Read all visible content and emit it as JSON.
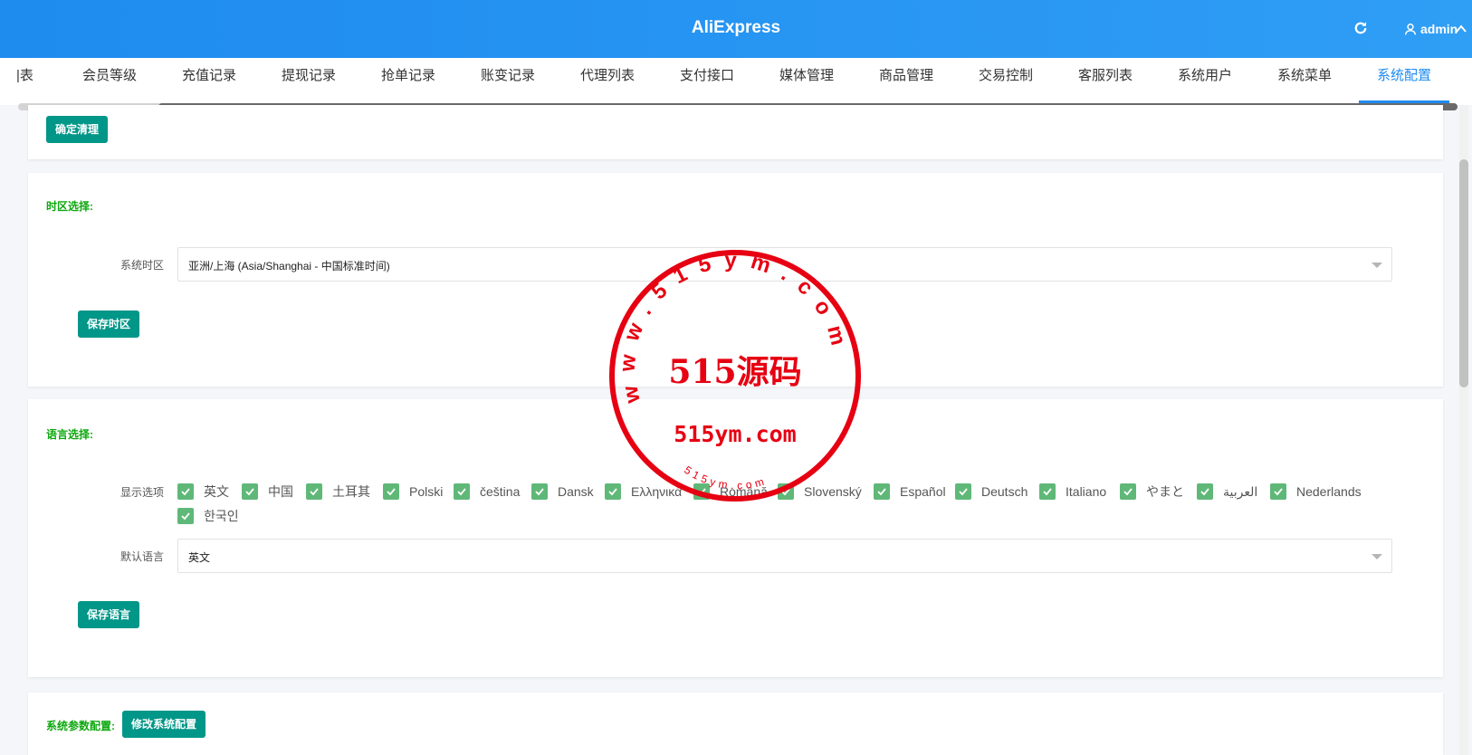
{
  "header": {
    "app_title": "AliExpress",
    "user_name": "admin",
    "refresh_icon": "refresh-icon",
    "user_icon": "user-icon",
    "caret_icon": "caret-up-icon",
    "brand_color": "#1e8bef"
  },
  "tabs": [
    {
      "label": "|表"
    },
    {
      "label": "会员等级"
    },
    {
      "label": "充值记录"
    },
    {
      "label": "提现记录"
    },
    {
      "label": "抢单记录"
    },
    {
      "label": "账变记录"
    },
    {
      "label": "代理列表"
    },
    {
      "label": "支付接口"
    },
    {
      "label": "媒体管理"
    },
    {
      "label": "商品管理"
    },
    {
      "label": "交易控制"
    },
    {
      "label": "客服列表"
    },
    {
      "label": "系统用户"
    },
    {
      "label": "系统菜单"
    },
    {
      "label": "系统配置",
      "active": true
    }
  ],
  "clear_card": {
    "confirm_clear_button": "确定清理"
  },
  "timezone": {
    "section_title": "时区选择:",
    "field_label": "系统时区",
    "selected_value": "亚洲/上海 (Asia/Shanghai - 中国标准时间)",
    "save_button": "保存时区"
  },
  "language": {
    "section_title": "语言选择:",
    "options_label": "显示选项",
    "options": [
      {
        "label": "英文",
        "checked": true
      },
      {
        "label": "中国",
        "checked": true
      },
      {
        "label": "土耳其",
        "checked": true
      },
      {
        "label": "Polski",
        "checked": true
      },
      {
        "label": "čeština",
        "checked": true
      },
      {
        "label": "Dansk",
        "checked": true
      },
      {
        "label": "Ελληνικά",
        "checked": true
      },
      {
        "label": "Română",
        "checked": true
      },
      {
        "label": "Slovenský",
        "checked": true
      },
      {
        "label": "Español",
        "checked": true
      },
      {
        "label": "Deutsch",
        "checked": true
      },
      {
        "label": "Italiano",
        "checked": true
      },
      {
        "label": "やまと",
        "checked": true
      },
      {
        "label": "العربية",
        "checked": true
      },
      {
        "label": "Nederlands",
        "checked": true
      },
      {
        "label": "한국인",
        "checked": true
      }
    ],
    "default_label": "默认语言",
    "default_value": "英文",
    "save_button": "保存语言"
  },
  "system_params": {
    "section_title": "系统参数配置:",
    "edit_button": "修改系统配置"
  },
  "watermark": {
    "ring_text": "www.515ym.com",
    "center_text": "515源码",
    "domain_text": "515ym.com",
    "bottom_text": "515ym.com",
    "color": "#e60012"
  }
}
